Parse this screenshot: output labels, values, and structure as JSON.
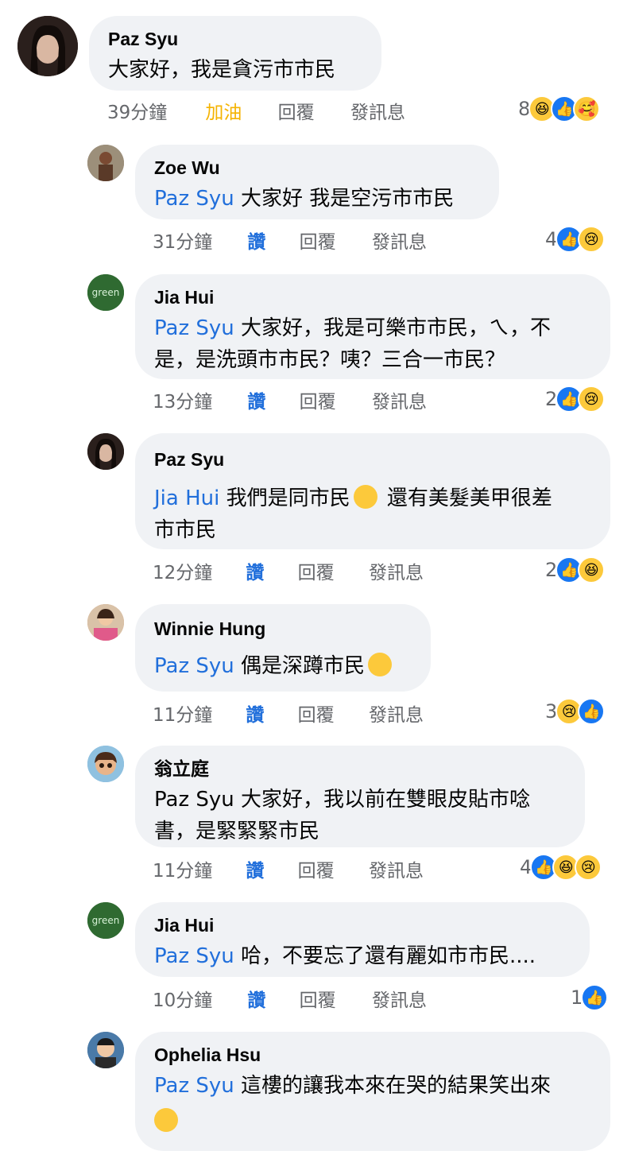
{
  "comments": [
    {
      "author": "Paz Syu",
      "mention": "",
      "text": "大家好，我是貪污市市民",
      "time": "39分鐘",
      "action1": "加油",
      "reply": "回覆",
      "message": "發訊息",
      "react_count": "8",
      "reactions": [
        "haha-icon",
        "like-icon",
        "care-icon"
      ]
    },
    {
      "author": "Zoe Wu",
      "mention": "Paz Syu",
      "text": "大家好 我是空污市市民",
      "time": "31分鐘",
      "action1": "讚",
      "reply": "回覆",
      "message": "發訊息",
      "react_count": "4",
      "reactions": [
        "like-icon",
        "sad-icon"
      ]
    },
    {
      "author": "Jia Hui",
      "mention": "Paz Syu",
      "text": "大家好，我是可樂市市民，ㄟ，不",
      "text2": "是，是洗頭市市民？咦？三合一市民？",
      "time": "13分鐘",
      "action1": "讚",
      "reply": "回覆",
      "message": "發訊息",
      "react_count": "2",
      "reactions": [
        "like-icon",
        "sad-icon"
      ]
    },
    {
      "author": "Paz Syu",
      "mention": "Jia Hui",
      "text": "我們是同市民",
      "text_after_emoji": "還有美髮美甲很差",
      "text2": "市市民",
      "time": "12分鐘",
      "action1": "讚",
      "reply": "回覆",
      "message": "發訊息",
      "react_count": "2",
      "reactions": [
        "like-icon",
        "haha-icon"
      ]
    },
    {
      "author": "Winnie Hung",
      "mention": "Paz Syu",
      "text": "偶是深蹲市民",
      "time": "11分鐘",
      "action1": "讚",
      "reply": "回覆",
      "message": "發訊息",
      "react_count": "3",
      "reactions": [
        "sad-icon",
        "like-icon"
      ]
    },
    {
      "author": "翁立庭",
      "mention": "",
      "text": "Paz Syu 大家好，我以前在雙眼皮貼市唸",
      "text2": "書，是緊緊緊市民",
      "time": "11分鐘",
      "action1": "讚",
      "reply": "回覆",
      "message": "發訊息",
      "react_count": "4",
      "reactions": [
        "like-icon",
        "haha-icon",
        "sad-icon"
      ]
    },
    {
      "author": "Jia Hui",
      "mention": "Paz Syu",
      "text": "哈，不要忘了還有麗如市市民....",
      "time": "10分鐘",
      "action1": "讚",
      "reply": "回覆",
      "message": "發訊息",
      "react_count": "1",
      "reactions": [
        "like-icon"
      ]
    },
    {
      "author": "Ophelia Hsu",
      "mention": "Paz Syu",
      "text": "這樓的讓我本來在哭的結果笑出來"
    }
  ],
  "colors": {
    "bubble": "#f0f2f5",
    "mention": "#216fdb",
    "meta": "#65676b",
    "like": "#1877f2",
    "cheer": "#f5b301"
  }
}
